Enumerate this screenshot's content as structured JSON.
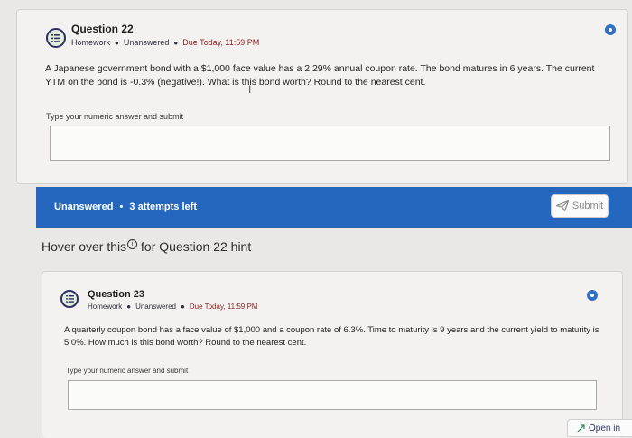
{
  "questions": [
    {
      "title": "Question 22",
      "type": "Homework",
      "status": "Unanswered",
      "due": "Due Today, 11:59 PM",
      "text": "A Japanese government bond with a $1,000 face value has a 2.29% annual coupon rate. The bond matures in 6 years. The current YTM on the bond is -0.3% (negative!). What is this bond worth? Round to the nearest cent.",
      "answer_label": "Type your numeric answer and submit",
      "answer_value": ""
    },
    {
      "title": "Question 23",
      "type": "Homework",
      "status": "Unanswered",
      "due": "Due Today, 11:59 PM",
      "text": "A quarterly coupon bond has a face value of $1,000 and a coupon rate of 6.3%. Time to maturity is 9 years and the current yield to maturity is 5.0%. How much is this bond worth? Round to the nearest cent.",
      "answer_label": "Type your numeric answer and submit",
      "answer_value": ""
    }
  ],
  "bar": {
    "status": "Unanswered",
    "attempts": "3 attempts left",
    "submit_label": "Submit"
  },
  "hint": {
    "prefix": "Hover over this",
    "suffix": "for Question 22 hint"
  },
  "open_in_label": "Open in",
  "colors": {
    "accent": "#2567bf",
    "due": "#8a1f1f"
  }
}
